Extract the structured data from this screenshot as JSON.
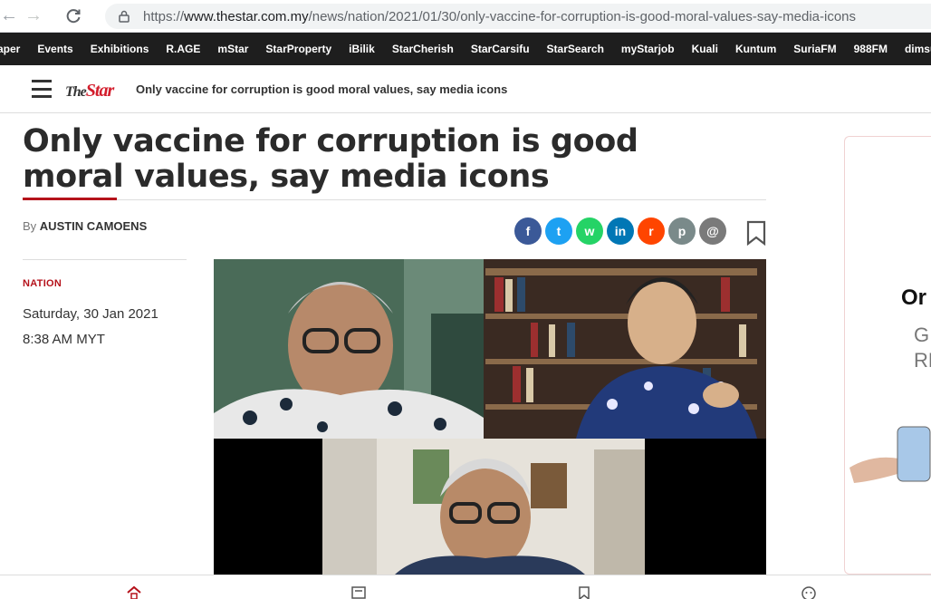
{
  "browser": {
    "url_prefix": "https://",
    "url_host": "www.thestar.com.my",
    "url_path": "/news/nation/2021/01/30/only-vaccine-for-corruption-is-good-moral-values-say-media-icons"
  },
  "top_nav": [
    "aper",
    "Events",
    "Exhibitions",
    "R.AGE",
    "mStar",
    "StarProperty",
    "iBilik",
    "StarCherish",
    "StarCarsifu",
    "StarSearch",
    "myStarjob",
    "Kuali",
    "Kuntum",
    "SuriaFM",
    "988FM",
    "dimsum.e"
  ],
  "header": {
    "logo_the": "The",
    "logo_star": "Star",
    "title": "Only vaccine for corruption is good moral values, say media icons"
  },
  "article": {
    "headline": "Only vaccine for corruption is good moral values, say media icons",
    "byline_prefix": "By",
    "author": "AUSTIN CAMOENS",
    "category": "NATION",
    "date": "Saturday, 30 Jan 2021",
    "time": "8:38 AM MYT"
  },
  "share": [
    {
      "name": "facebook-share-icon",
      "glyph": "f",
      "color": "#3b5998"
    },
    {
      "name": "twitter-share-icon",
      "glyph": "t",
      "color": "#1da1f2"
    },
    {
      "name": "whatsapp-share-icon",
      "glyph": "w",
      "color": "#25d366"
    },
    {
      "name": "linkedin-share-icon",
      "glyph": "in",
      "color": "#0077b5"
    },
    {
      "name": "reddit-share-icon",
      "glyph": "r",
      "color": "#ff4500"
    },
    {
      "name": "print-share-icon",
      "glyph": "p",
      "color": "#7a8a8a"
    },
    {
      "name": "email-share-icon",
      "glyph": "@",
      "color": "#7a7a7a"
    }
  ],
  "ad": {
    "line1": "Or",
    "line2": "G",
    "line3": "RM"
  },
  "colors": {
    "accent": "#b5121b",
    "logo_red": "#d31d2c"
  }
}
